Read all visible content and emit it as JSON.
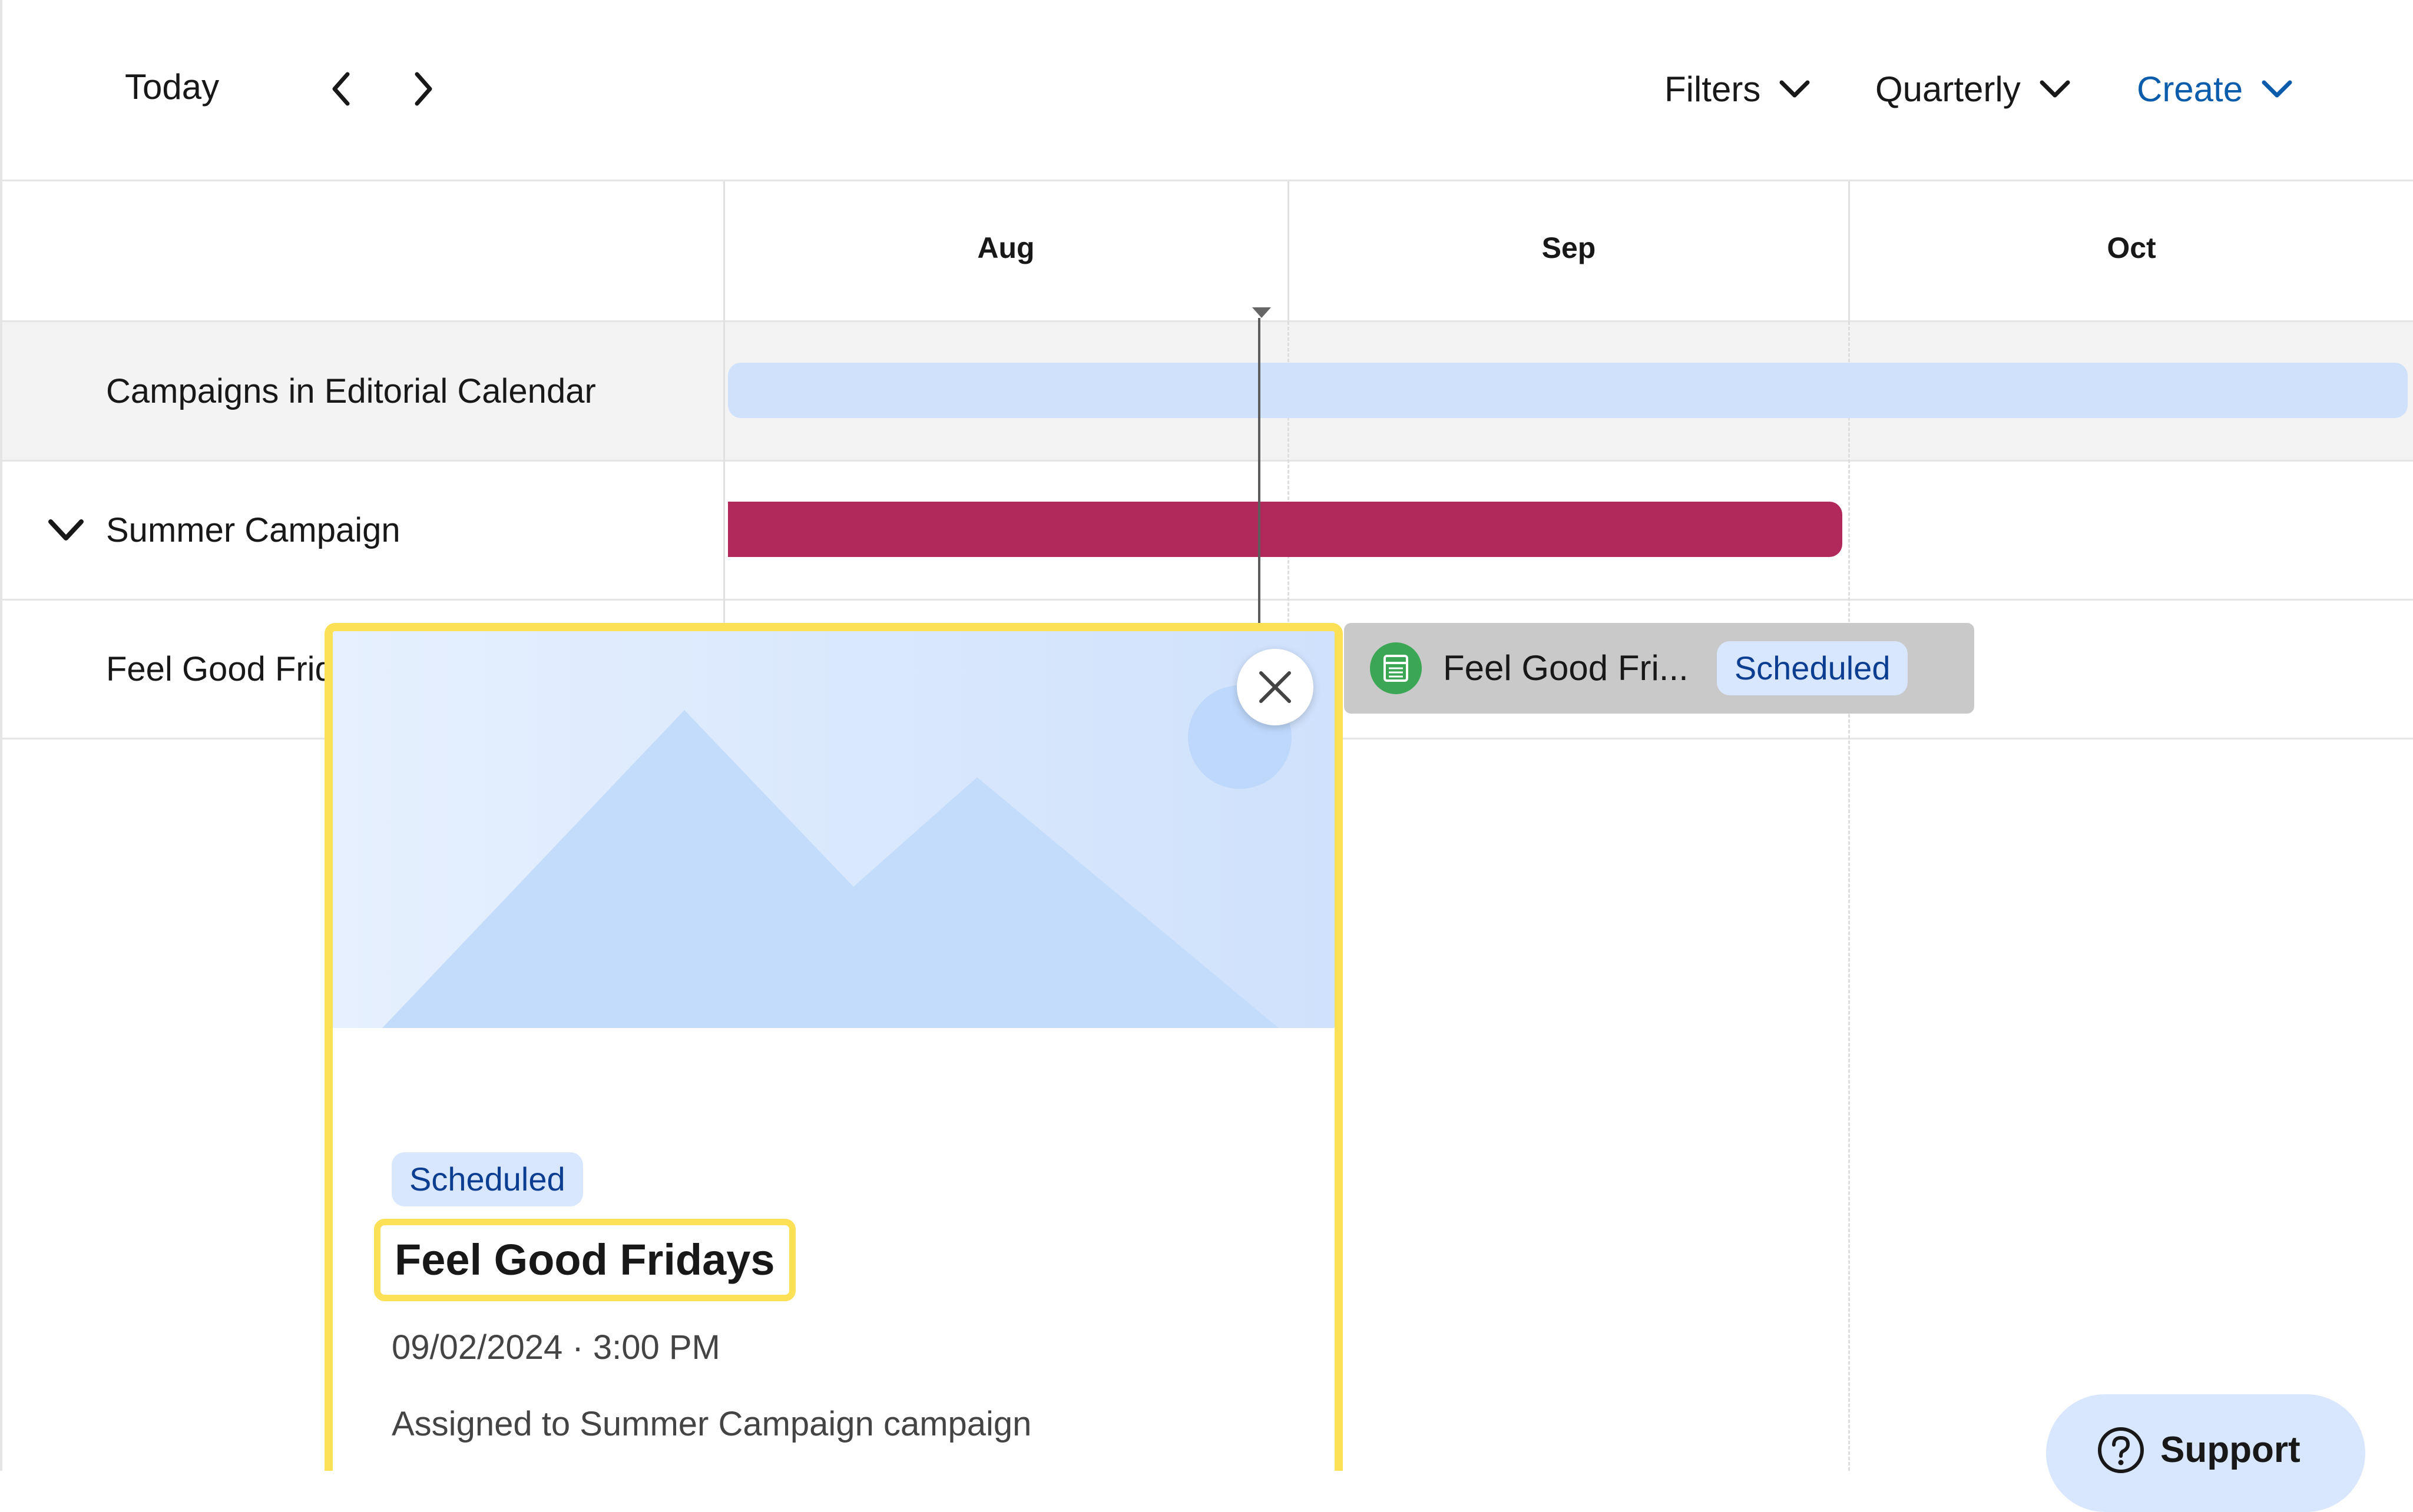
{
  "toolbar": {
    "today_label": "Today",
    "filters_label": "Filters",
    "view_label": "Quarterly",
    "create_label": "Create"
  },
  "timeline": {
    "months": [
      "Aug",
      "Sep",
      "Oct"
    ]
  },
  "rows": {
    "campaigns_header": "Campaigns in Editorial Calendar",
    "summer_campaign": "Summer Campaign",
    "feel_good_row": "Feel Good Fridays"
  },
  "event_chip": {
    "title": "Feel Good Fri...",
    "status": "Scheduled"
  },
  "popover": {
    "status": "Scheduled",
    "title": "Feel Good Fridays",
    "datetime": "09/02/2024 · 3:00 PM",
    "assignment": "Assigned to Summer Campaign campaign"
  },
  "support": {
    "label": "Support"
  },
  "colors": {
    "accent_blue": "#0b5cab",
    "campaign_bar": "#b0295a",
    "campaigns_bar": "#cfe1fb",
    "highlight": "#fce055",
    "badge_bg": "#d8e6fe"
  },
  "icons": {
    "prev": "chevron-left-icon",
    "next": "chevron-right-icon",
    "dropdown": "chevron-down-icon",
    "close": "close-icon",
    "content": "spreadsheet-icon",
    "help": "question-icon"
  }
}
